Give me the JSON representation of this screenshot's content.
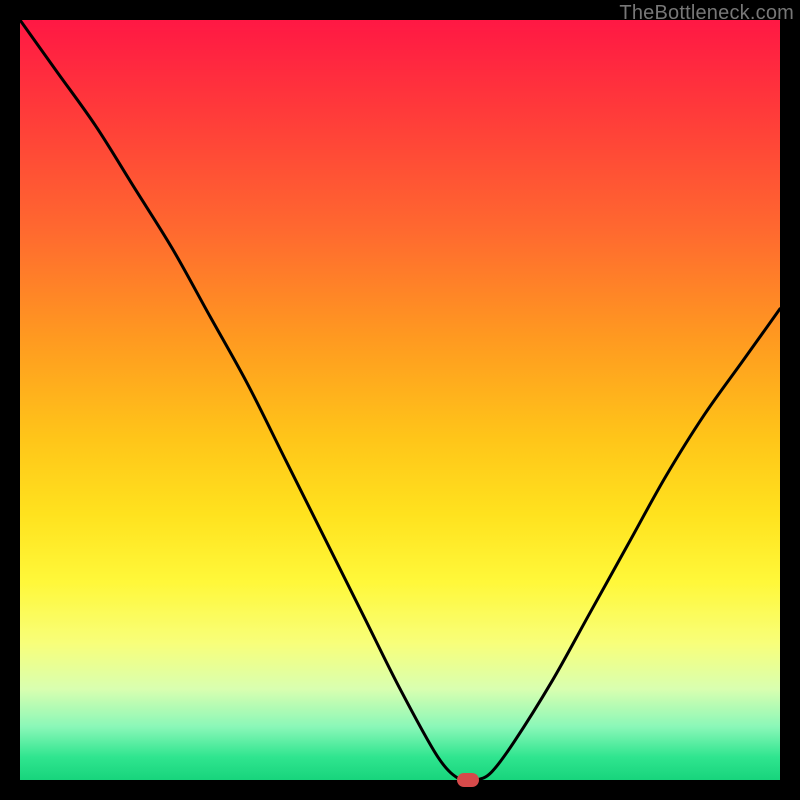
{
  "watermark": "TheBottleneck.com",
  "chart_data": {
    "type": "line",
    "title": "",
    "xlabel": "",
    "ylabel": "",
    "xlim": [
      0,
      100
    ],
    "ylim": [
      0,
      100
    ],
    "grid": false,
    "legend": false,
    "series": [
      {
        "name": "bottleneck-curve",
        "x": [
          0,
          5,
          10,
          15,
          20,
          25,
          30,
          35,
          40,
          45,
          50,
          55,
          58,
          60,
          62,
          65,
          70,
          75,
          80,
          85,
          90,
          95,
          100
        ],
        "y": [
          100,
          93,
          86,
          78,
          70,
          61,
          52,
          42,
          32,
          22,
          12,
          3,
          0,
          0,
          1,
          5,
          13,
          22,
          31,
          40,
          48,
          55,
          62
        ]
      }
    ],
    "annotations": [
      {
        "name": "minimum-marker",
        "x": 59,
        "y": 0,
        "shape": "pill",
        "color": "#d64a4a"
      }
    ],
    "background_gradient": {
      "top": "#ff1844",
      "bottom": "#18d47c",
      "direction": "vertical",
      "meaning": "red=high bottleneck, green=low bottleneck"
    }
  }
}
